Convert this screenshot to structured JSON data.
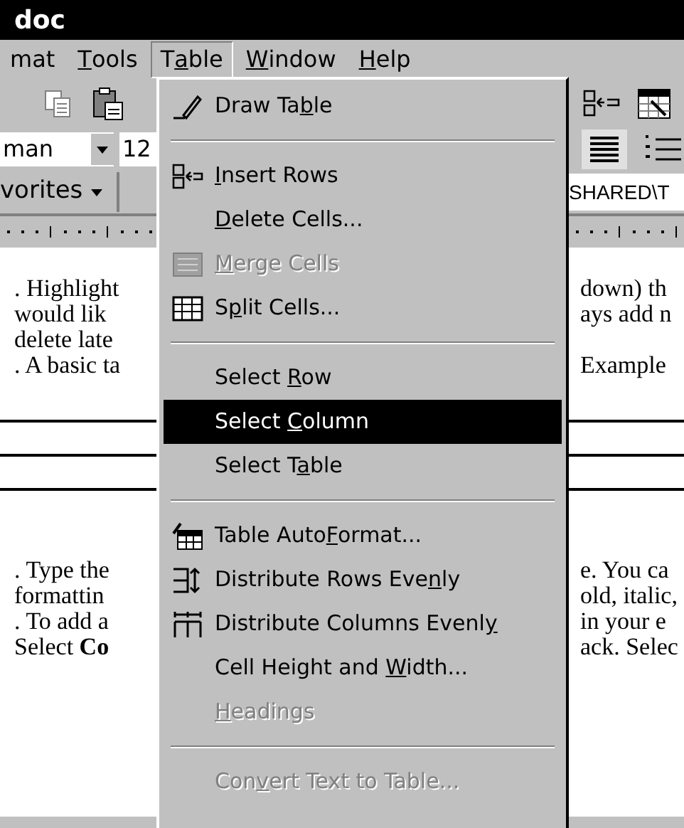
{
  "window": {
    "title": "doc"
  },
  "menu_bar": [
    {
      "label": {
        "pre": "mat"
      },
      "selected": false
    },
    {
      "label": {
        "key": "T",
        "post": "ools"
      },
      "selected": false
    },
    {
      "label": {
        "pre": "T",
        "key": "a",
        "post": "ble"
      },
      "selected": true
    },
    {
      "label": {
        "key": "W",
        "post": "indow"
      },
      "selected": false
    },
    {
      "label": {
        "key": "H",
        "post": "elp"
      },
      "selected": false
    }
  ],
  "toolbar": {
    "font": "man",
    "size": "12",
    "favorites": "vorites",
    "address": "SHARED\\T"
  },
  "table_menu": [
    {
      "kind": "item",
      "label": {
        "pre": "Draw Ta",
        "key": "b",
        "post": "le"
      },
      "disabled": false,
      "selected": false
    },
    {
      "kind": "separator"
    },
    {
      "kind": "item",
      "label": {
        "key": "I",
        "post": "nsert Rows"
      },
      "disabled": false,
      "selected": false
    },
    {
      "kind": "item",
      "label": {
        "key": "D",
        "post": "elete Cells..."
      },
      "disabled": false,
      "selected": false
    },
    {
      "kind": "item",
      "label": {
        "key": "M",
        "post": "erge Cells"
      },
      "disabled": true,
      "selected": false
    },
    {
      "kind": "item",
      "label": {
        "pre": "S",
        "key": "p",
        "post": "lit Cells..."
      },
      "disabled": false,
      "selected": false
    },
    {
      "kind": "separator"
    },
    {
      "kind": "item",
      "label": {
        "pre": "Select ",
        "key": "R",
        "post": "ow"
      },
      "disabled": false,
      "selected": false
    },
    {
      "kind": "item",
      "label": {
        "pre": "Select ",
        "key": "C",
        "post": "olumn"
      },
      "disabled": false,
      "selected": true
    },
    {
      "kind": "item",
      "label": {
        "pre": "Select T",
        "key": "a",
        "post": "ble"
      },
      "disabled": false,
      "selected": false
    },
    {
      "kind": "separator"
    },
    {
      "kind": "item",
      "label": {
        "pre": "Table Auto",
        "key": "F",
        "post": "ormat..."
      },
      "disabled": false,
      "selected": false
    },
    {
      "kind": "item",
      "label": {
        "pre": "Distribute Rows Eve",
        "key": "n",
        "post": "ly"
      },
      "disabled": false,
      "selected": false
    },
    {
      "kind": "item",
      "label": {
        "pre": "Distribute Columns Evenl",
        "key": "y"
      },
      "disabled": false,
      "selected": false
    },
    {
      "kind": "item",
      "label": {
        "pre": "Cell Height and ",
        "key": "W",
        "post": "idth..."
      },
      "disabled": false,
      "selected": false
    },
    {
      "kind": "item",
      "label": {
        "key": "H",
        "post": "eadings"
      },
      "disabled": true,
      "selected": false
    },
    {
      "kind": "separator"
    },
    {
      "kind": "item",
      "label": {
        "pre": "Con",
        "key": "v",
        "post": "ert Text to Table..."
      },
      "disabled": true,
      "selected": false
    }
  ],
  "document": {
    "rows": [
      {
        "kind": "text",
        "left": ". Highlight",
        "right": "down) th"
      },
      {
        "kind": "text",
        "left": "would lik",
        "right": "ays add n"
      },
      {
        "kind": "text",
        "left": "delete late"
      },
      {
        "kind": "text",
        "left": ". A basic ta",
        "right": "Example"
      },
      {
        "kind": "gap"
      },
      {
        "kind": "rule"
      },
      {
        "kind": "rule"
      },
      {
        "kind": "rule"
      },
      {
        "kind": "gap"
      },
      {
        "kind": "gap"
      },
      {
        "kind": "text",
        "left": ". Type the",
        "right": "e. You ca"
      },
      {
        "kind": "text",
        "left": "formattin",
        "right": "old, italic,"
      },
      {
        "kind": "text",
        "left": ". To add a",
        "right": "in your e"
      },
      {
        "kind": "text",
        "left": "Select **Co**",
        "right": "ack. Selec"
      }
    ]
  }
}
